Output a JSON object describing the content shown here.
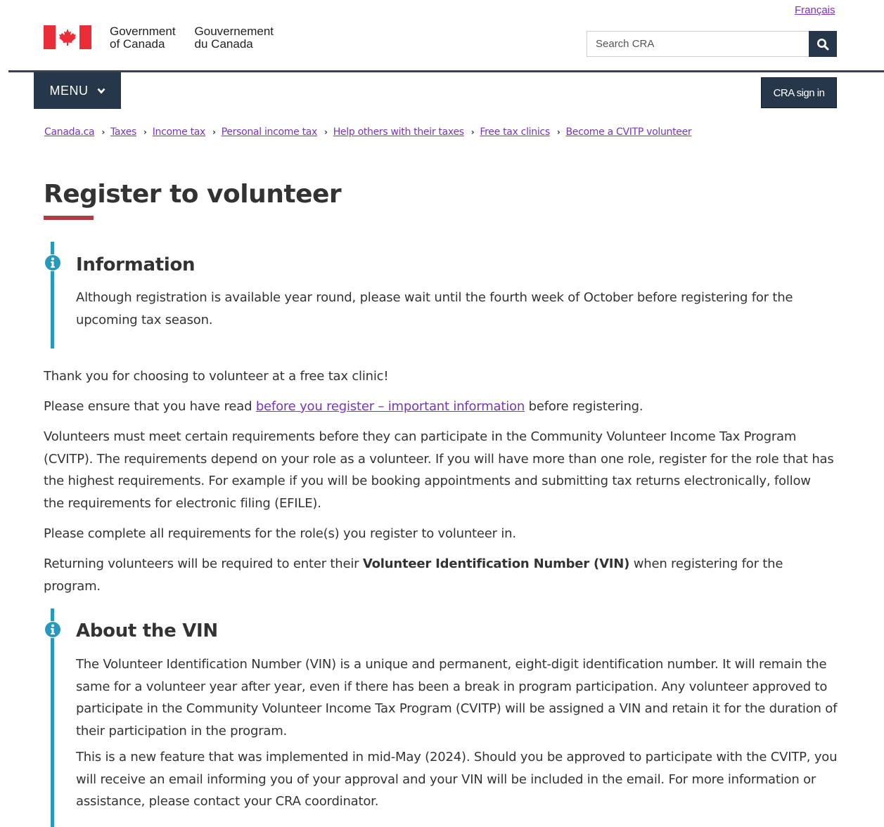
{
  "header": {
    "language_link": "Français",
    "gov_name_en_line1": "Government",
    "gov_name_en_line2": "of Canada",
    "gov_name_fr_line1": "Gouvernement",
    "gov_name_fr_line2": "du Canada",
    "search_placeholder": "Search CRA",
    "search_icon": "search-icon",
    "menu_label": "MENU",
    "menu_icon": "chevron-down-icon",
    "signin_label": "CRA sign in"
  },
  "breadcrumb": [
    "Canada.ca",
    "Taxes",
    "Income tax",
    "Personal income tax",
    "Help others with their taxes",
    "Free tax clinics",
    "Become a CVITP volunteer"
  ],
  "main": {
    "title": "Register to volunteer",
    "info_alert": {
      "icon": "info-icon",
      "heading": "Information",
      "text": "Although registration is available year round, please wait until the fourth week of October before registering for the upcoming tax season."
    },
    "para_thanks": "Thank you for choosing to volunteer at a free tax clinic!",
    "para_ensure_before": "Please ensure that you have read ",
    "para_ensure_link": "before you register – important information",
    "para_ensure_after": " before registering.",
    "para_requirements": "Volunteers must meet certain requirements before they can participate in the Community Volunteer Income Tax Program (CVITP). The requirements depend on your role as a volunteer. If you will have more than one role, register for the role that has the highest requirements. For example if you will be booking appointments and submitting tax returns electronically, follow the requirements for electronic filing (EFILE).",
    "para_complete": "Please complete all requirements for the role(s) you register to volunteer in.",
    "para_returning_before": "Returning volunteers will be required to enter their ",
    "para_returning_bold": "Volunteer Identification Number (VIN)",
    "para_returning_after": " when registering for the program.",
    "vin_alert": {
      "icon": "info-icon",
      "heading": "About the VIN",
      "text1": "The Volunteer Identification Number (VIN) is a unique and permanent, eight-digit identification number. It will remain the same for a volunteer year after year, even if there has been a break in program participation. Any volunteer approved to participate in the Community Volunteer Income Tax Program (CVITP) will be assigned a VIN and retain it for the duration of their participation in the program.",
      "text2": "This is a new feature that was implemented in mid-May (2024). Should you be approved to participate with the CVITP, you will receive an email informing you of your approval and your VIN will be included in the email. For more information or assistance, please contact your CRA coordinator."
    }
  },
  "colors": {
    "brand_dark": "#26374a",
    "flag_red": "#eb2d37",
    "title_rule": "#af3c43",
    "alert_info": "#269abc",
    "link_visited": "#7834bc"
  }
}
